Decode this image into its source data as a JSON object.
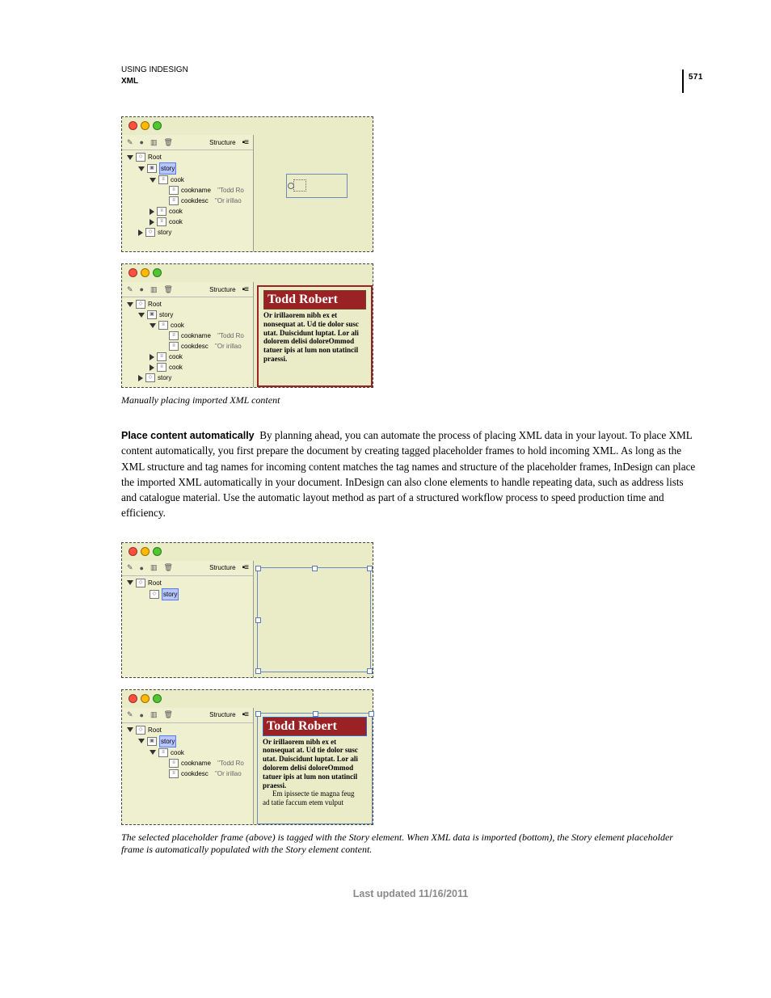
{
  "page": {
    "number": "571"
  },
  "runhead": {
    "line1": "USING INDESIGN",
    "line2": "XML"
  },
  "panel": {
    "title": "Structure"
  },
  "tree_a": {
    "root": "Root",
    "story1": "story",
    "cook1": "cook",
    "cookname_label": "cookname",
    "cookname_snip": "\"Todd Ro",
    "cookdesc_label": "cookdesc",
    "cookdesc_snip": "\"Or irillao",
    "cook2": "cook",
    "cook3": "cook",
    "story2": "story"
  },
  "sample": {
    "heading": "Todd Robert",
    "body": "Or irillaorem nibh ex et nonsequat at. Ud tie dolor susc utat. Duiscidunt luptat. Lor ali dolorem delisi doloreOmmod tatuer ipis at lum non utatincil praessi.",
    "body_cont1": "Em ipissecte tie magna feug",
    "body_cont2": "ad tatie faccum etem vulput"
  },
  "captions": {
    "fig1": "Manually placing imported XML content",
    "fig2": "The selected placeholder frame (above) is tagged with the Story element. When XML data is imported (bottom), the Story element placeholder frame is automatically populated with the Story element content."
  },
  "para": {
    "lead": "Place content automatically",
    "text": "By planning ahead, you can automate the process of placing XML data in your layout. To place XML content automatically, you first prepare the document by creating tagged placeholder frames to hold incoming XML. As long as the XML structure and tag names for incoming content matches the tag names and structure of the placeholder frames, InDesign can place the imported XML automatically in your document. InDesign can also clone elements to handle repeating data, such as address lists and catalogue material. Use the automatic layout method as part of a structured workflow process to speed production time and efficiency."
  },
  "footer": {
    "text": "Last updated 11/16/2011"
  }
}
